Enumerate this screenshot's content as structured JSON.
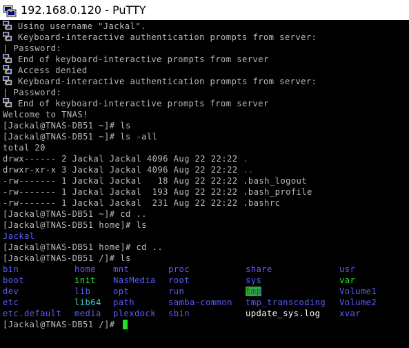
{
  "window": {
    "title": "192.168.0.120 - PuTTY",
    "icon": "putty-terminal-icon"
  },
  "auth_lines": [
    {
      "icon": "key-icon",
      "text": "Using username \"Jackal\"."
    },
    {
      "icon": "key-icon",
      "text": "Keyboard-interactive authentication prompts from server:"
    },
    {
      "icon": null,
      "text": "| Password:"
    },
    {
      "icon": "key-icon",
      "text": "End of keyboard-interactive prompts from server"
    },
    {
      "icon": "key-icon",
      "text": "Access denied"
    },
    {
      "icon": "key-icon",
      "text": "Keyboard-interactive authentication prompts from server:"
    },
    {
      "icon": null,
      "text": "| Password:"
    },
    {
      "icon": "key-icon",
      "text": "End of keyboard-interactive prompts from server"
    }
  ],
  "welcome": "Welcome to TNAS!",
  "session": {
    "cmd1": "[Jackal@TNAS-DB51 ~]# ls",
    "cmd2": "[Jackal@TNAS-DB51 ~]# ls -all",
    "total": "total 20",
    "listing": [
      {
        "meta": "drwx------ 2 Jackal Jackal 4096 Aug 22 22:22 ",
        "name": ".",
        "color": "blue"
      },
      {
        "meta": "drwxr-xr-x 3 Jackal Jackal 4096 Aug 22 22:22 ",
        "name": "..",
        "color": "blue"
      },
      {
        "meta": "-rw------- 1 Jackal Jackal   18 Aug 22 22:22 ",
        "name": ".bash_logout",
        "color": "plain"
      },
      {
        "meta": "-rw------- 1 Jackal Jackal  193 Aug 22 22:22 ",
        "name": ".bash_profile",
        "color": "plain"
      },
      {
        "meta": "-rw------- 1 Jackal Jackal  231 Aug 22 22:22 ",
        "name": ".bashrc",
        "color": "plain"
      }
    ],
    "cmd3": "[Jackal@TNAS-DB51 ~]# cd ..",
    "cmd4": "[Jackal@TNAS-DB51 home]# ls",
    "home_listing": "Jackal",
    "cmd5": "[Jackal@TNAS-DB51 home]# cd ..",
    "cmd6": "[Jackal@TNAS-DB51 /]# ls",
    "root_listing": [
      [
        {
          "t": "bin",
          "c": "blue"
        },
        {
          "t": "home",
          "c": "blue"
        },
        {
          "t": "mnt",
          "c": "blue"
        },
        {
          "t": "proc",
          "c": "blue"
        },
        {
          "t": "share",
          "c": "blue"
        },
        {
          "t": "usr",
          "c": "blue"
        }
      ],
      [
        {
          "t": "boot",
          "c": "blue"
        },
        {
          "t": "init",
          "c": "green"
        },
        {
          "t": "NasMedia",
          "c": "blue"
        },
        {
          "t": "root",
          "c": "blue"
        },
        {
          "t": "sys",
          "c": "blue"
        },
        {
          "t": "var",
          "c": "green"
        }
      ],
      [
        {
          "t": "dev",
          "c": "blue"
        },
        {
          "t": "lib",
          "c": "blue"
        },
        {
          "t": "opt",
          "c": "blue"
        },
        {
          "t": "run",
          "c": "blue"
        },
        {
          "t": "tmp",
          "c": "tmp"
        },
        {
          "t": "Volume1",
          "c": "blue"
        }
      ],
      [
        {
          "t": "etc",
          "c": "blue"
        },
        {
          "t": "lib64",
          "c": "cyan"
        },
        {
          "t": "path",
          "c": "blue"
        },
        {
          "t": "samba-common",
          "c": "blue"
        },
        {
          "t": "tmp_transcoding",
          "c": "blue"
        },
        {
          "t": "Volume2",
          "c": "blue"
        }
      ],
      [
        {
          "t": "etc.default",
          "c": "blue"
        },
        {
          "t": "media",
          "c": "blue"
        },
        {
          "t": "plexdock",
          "c": "blue"
        },
        {
          "t": "sbin",
          "c": "blue"
        },
        {
          "t": "update_sys.log",
          "c": "white"
        },
        {
          "t": "xvar",
          "c": "blue"
        }
      ]
    ],
    "prompt": "[Jackal@TNAS-DB51 /]# "
  }
}
